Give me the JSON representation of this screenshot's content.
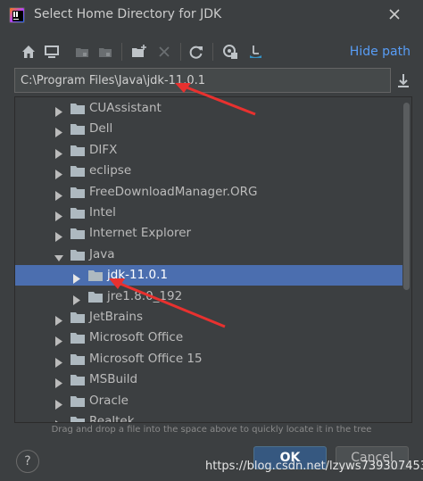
{
  "window": {
    "title": "Select Home Directory for JDK",
    "close_icon": "close-icon",
    "logo_icon": "intellij-logo-icon"
  },
  "toolbar": {
    "icons": [
      "home-icon",
      "desktop-icon",
      "project-icon",
      "module-icon",
      "new-folder-icon",
      "delete-icon",
      "refresh-icon",
      "show-hidden-icon",
      "folder-link-icon"
    ],
    "hide_path_label": "Hide path"
  },
  "path": {
    "value": "C:\\Program Files\\Java\\jdk-11.0.1",
    "download_icon": "download-icon"
  },
  "tree": {
    "items": [
      {
        "label": "CUAssistant",
        "expanded": false,
        "level": 0,
        "selected": false
      },
      {
        "label": "Dell",
        "expanded": false,
        "level": 0,
        "selected": false
      },
      {
        "label": "DIFX",
        "expanded": false,
        "level": 0,
        "selected": false
      },
      {
        "label": "eclipse",
        "expanded": false,
        "level": 0,
        "selected": false
      },
      {
        "label": "FreeDownloadManager.ORG",
        "expanded": false,
        "level": 0,
        "selected": false
      },
      {
        "label": "Intel",
        "expanded": false,
        "level": 0,
        "selected": false
      },
      {
        "label": "Internet Explorer",
        "expanded": false,
        "level": 0,
        "selected": false
      },
      {
        "label": "Java",
        "expanded": true,
        "level": 0,
        "selected": false
      },
      {
        "label": "jdk-11.0.1",
        "expanded": false,
        "level": 1,
        "selected": true
      },
      {
        "label": "jre1.8.0_192",
        "expanded": false,
        "level": 1,
        "selected": false
      },
      {
        "label": "JetBrains",
        "expanded": false,
        "level": 0,
        "selected": false
      },
      {
        "label": "Microsoft Office",
        "expanded": false,
        "level": 0,
        "selected": false
      },
      {
        "label": "Microsoft Office 15",
        "expanded": false,
        "level": 0,
        "selected": false
      },
      {
        "label": "MSBuild",
        "expanded": false,
        "level": 0,
        "selected": false
      },
      {
        "label": "Oracle",
        "expanded": false,
        "level": 0,
        "selected": false
      },
      {
        "label": "Realtek",
        "expanded": false,
        "level": 0,
        "selected": false
      }
    ]
  },
  "hint": "Drag and drop a file into the space above to quickly locate it in the tree",
  "footer": {
    "help_label": "?",
    "ok_label": "OK",
    "cancel_label": "Cancel"
  },
  "watermark": "https://blog.csdn.net/lzyws739307453",
  "colors": {
    "background": "#3c3f41",
    "selection": "#4b6eaf",
    "link": "#589df6",
    "annotation_arrow": "#e8312f",
    "folder": "#aeb9c0"
  }
}
